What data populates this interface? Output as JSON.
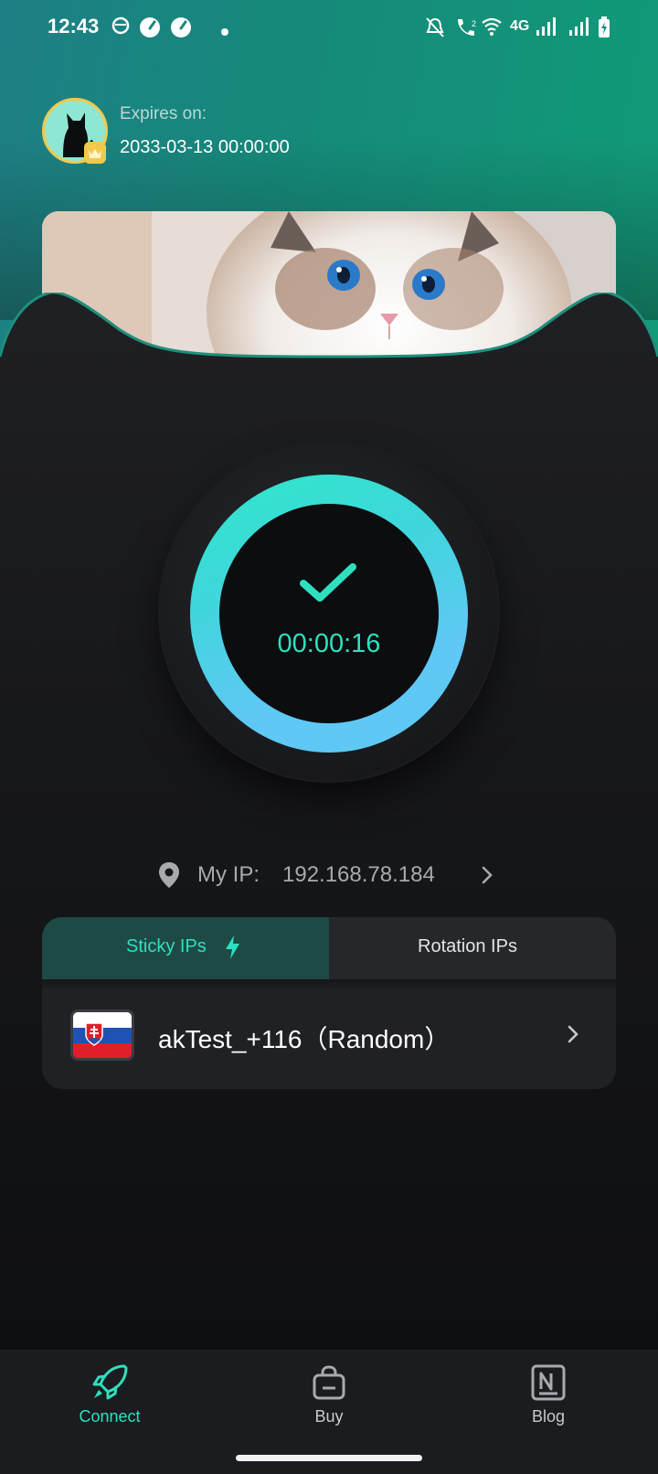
{
  "status_bar": {
    "time": "12:43",
    "network_label": "4G",
    "icons": [
      "app-icon",
      "speed-icon",
      "speed-icon",
      "dot",
      "bell-off-icon",
      "call-icon",
      "wifi-icon",
      "signal-icon",
      "signal-icon",
      "battery-charging-icon"
    ]
  },
  "account": {
    "expires_label": "Expires on:",
    "expires_value": "2033-03-13 00:00:00"
  },
  "connection": {
    "state": "connected",
    "timer": "00:00:16",
    "colors": {
      "accent": "#2ee0bf",
      "ring_start": "#2ee8c8",
      "ring_end": "#5ec9f6"
    }
  },
  "ip": {
    "label": "My IP:",
    "value": "192.168.78.184"
  },
  "tabs": [
    {
      "label": "Sticky IPs",
      "active": true,
      "icon": "lightning-icon"
    },
    {
      "label": "Rotation IPs",
      "active": false
    }
  ],
  "server": {
    "name": "akTest_+116（Random）",
    "flag": "slovakia-flag"
  },
  "bottom_nav": [
    {
      "label": "Connect",
      "icon": "rocket-icon",
      "active": true
    },
    {
      "label": "Buy",
      "icon": "bag-icon",
      "active": false
    },
    {
      "label": "Blog",
      "icon": "news-icon",
      "active": false
    }
  ]
}
